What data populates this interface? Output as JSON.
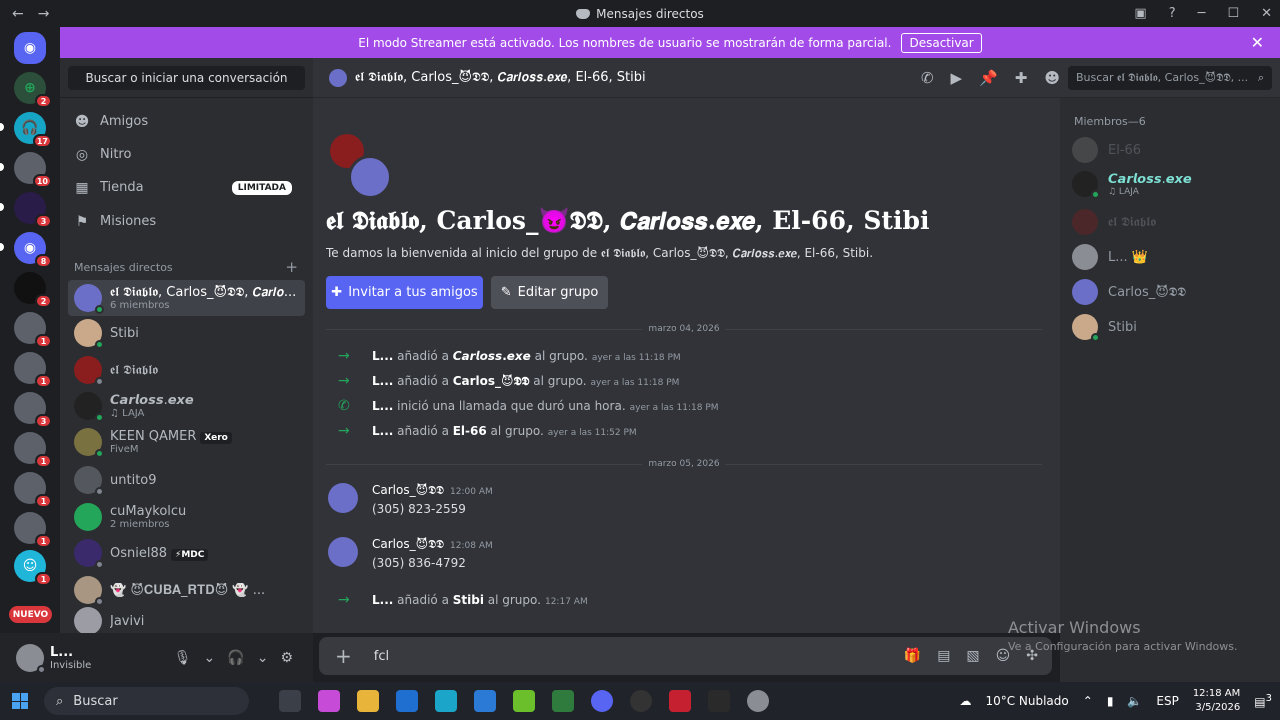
{
  "window": {
    "title": "Mensajes directos"
  },
  "banner": {
    "text": "El modo Streamer está activado. Los nombres de usuario se mostrarán de forma parcial.",
    "button": "Desactivar",
    "color": "#a34be8"
  },
  "sidebar": {
    "search": "Buscar o iniciar una conversación",
    "nav": [
      {
        "label": "Amigos",
        "icon": "friends-icon"
      },
      {
        "label": "Nitro",
        "icon": "nitro-icon"
      },
      {
        "label": "Tienda",
        "icon": "shop-icon",
        "tag": "LIMITADA"
      },
      {
        "label": "Misiones",
        "icon": "quests-icon"
      }
    ],
    "dm_header": "Mensajes directos",
    "dms": [
      {
        "name": "𝖊𝖑 𝕯𝖎𝖆𝖇𝖑𝖔, Carlos_😈𝕯𝕯, 𝘾𝙖𝙧𝙡𝙤...",
        "sub": "6 miembros"
      },
      {
        "name": "Stibi",
        "sub": ""
      },
      {
        "name": "𝖊𝖑 𝕯𝖎𝖆𝖇𝖑𝖔",
        "sub": ""
      },
      {
        "name": "𝘾𝙖𝙧𝙡𝙤𝙨𝙨.𝙚𝙭𝙚",
        "sub": "♫ LAJA"
      },
      {
        "name": "KEEN QAMER",
        "tag": "Xero",
        "sub": "FiveM"
      },
      {
        "name": "untito9",
        "sub": ""
      },
      {
        "name": "cuMaykolcu",
        "sub": "2 miembros"
      },
      {
        "name": "Osniel88",
        "tag": "⚡MDC",
        "sub": ""
      },
      {
        "name": "👻 😈𝐂𝐔𝐁𝐀_𝐑𝐓𝐃😈 👻 ...",
        "sub": ""
      },
      {
        "name": "Javivi",
        "sub": ""
      }
    ]
  },
  "servers": {
    "badges": [
      "2",
      "17",
      "10",
      "3",
      "8",
      "2",
      "1",
      "1",
      "3",
      "1",
      "1",
      "1",
      "1"
    ],
    "new": "NUEVO"
  },
  "user": {
    "name": "L...",
    "status": "Invisible"
  },
  "header": {
    "title": "𝖊𝖑 𝕯𝖎𝖆𝖇𝖑𝖔, Carlos_😈𝕯𝕯, 𝘾𝙖𝙧𝙡𝙤𝙨𝙨.𝙚𝙭𝙚, El-66, Stibi",
    "search": "Buscar 𝖊𝖑 𝕯𝖎𝖆𝖇𝖑𝖔, Carlos_😈𝕯𝕯, ..."
  },
  "chat": {
    "group_title": "𝖊𝖑 𝕯𝖎𝖆𝖇𝖑𝖔, Carlos_😈𝕯𝕯, 𝘾𝙖𝙧𝙡𝙤𝙨𝙨.𝙚𝙭𝙚, El-66, Stibi",
    "welcome": "Te damos la bienvenida al inicio del grupo de 𝖊𝖑 𝕯𝖎𝖆𝖇𝖑𝖔, Carlos_😈𝕯𝕯, 𝘾𝙖𝙧𝙡𝙤𝙨𝙨.𝙚𝙭𝙚, El-66, Stibi.",
    "invite": "Invitar a tus amigos",
    "edit": "Editar grupo",
    "date1": "marzo 04, 2026",
    "date2": "marzo 05, 2026",
    "events": [
      {
        "actor": "L...",
        "action": " añadió a ",
        "target": "𝘾𝙖𝙧𝙡𝙤𝙨𝙨.𝙚𝙭𝙚",
        "tail": " al grupo.",
        "ts": "ayer a las 11:18 PM"
      },
      {
        "actor": "L...",
        "action": " añadió a ",
        "target": "Carlos_😈𝕯𝕯",
        "tail": " al grupo.",
        "ts": "ayer a las 11:18 PM"
      },
      {
        "actor": "L...",
        "action": " inició una llamada que duró una hora.",
        "target": "",
        "tail": "",
        "ts": "ayer a las 11:18 PM"
      },
      {
        "actor": "L...",
        "action": " añadió a ",
        "target": "El-66",
        "tail": " al grupo.",
        "ts": "ayer a las 11:52 PM"
      },
      {
        "actor": "L...",
        "action": " añadió a ",
        "target": "Stibi",
        "tail": " al grupo.",
        "ts": "12:17 AM"
      }
    ],
    "messages": [
      {
        "author": "Carlos_😈𝕯𝕯",
        "ts": "12:00 AM",
        "text": "(305) 823-2559"
      },
      {
        "author": "Carlos_😈𝕯𝕯",
        "ts": "12:08 AM",
        "text": "(305) 836-4792"
      }
    ],
    "composer_value": "fcl"
  },
  "members": {
    "header": "Miembros—6",
    "list": [
      {
        "name": "El-66",
        "sub": ""
      },
      {
        "name": "𝘾𝙖𝙧𝙡𝙤𝙨𝙨.𝙚𝙭𝙚",
        "sub": "♫ LAJA"
      },
      {
        "name": "𝖊𝖑 𝕯𝖎𝖆𝖇𝖑𝖔",
        "sub": ""
      },
      {
        "name": "L... 👑",
        "sub": ""
      },
      {
        "name": "Carlos_😈𝕯𝕯",
        "sub": ""
      },
      {
        "name": "Stibi",
        "sub": ""
      }
    ]
  },
  "watermark": {
    "title": "Activar Windows",
    "sub": "Ve a Configuración para activar Windows."
  },
  "taskbar": {
    "search": "Buscar",
    "weather": "10°C  Nublado",
    "lang": "ESP",
    "time": "12:18 AM",
    "date": "3/5/2026",
    "notif": "3"
  }
}
